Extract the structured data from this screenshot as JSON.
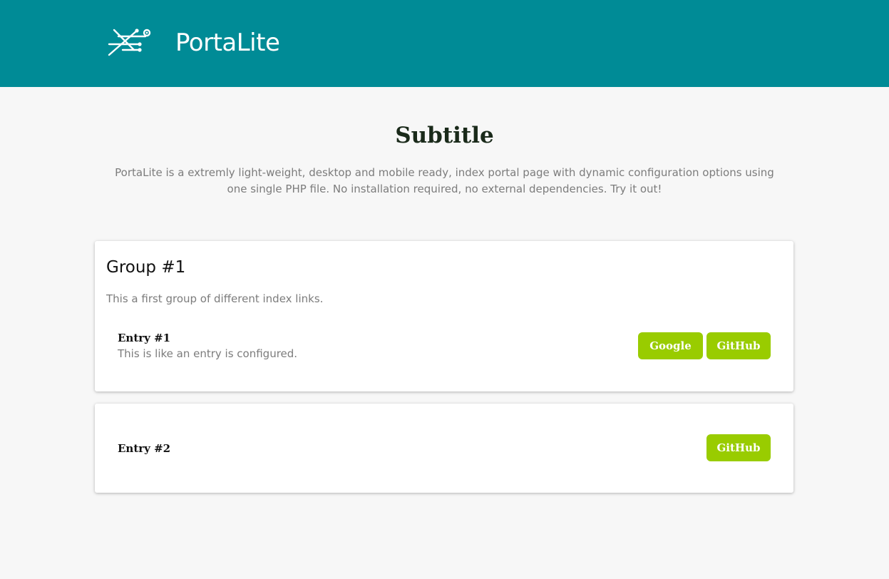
{
  "header": {
    "app_title": "PortaLite",
    "logo_icon": "circuit-logo-icon",
    "background_color": "#008b96"
  },
  "hero": {
    "subtitle": "Subtitle",
    "intro": "PortaLite is a extremly light-weight, desktop and mobile ready, index portal page with dynamic configuration options using one single PHP file. No installation required, no external dependencies. Try it out!"
  },
  "groups": [
    {
      "title": "Group #1",
      "description": "This a first group of different index links.",
      "entries": [
        {
          "title": "Entry #1",
          "description": "This is like an entry is configured.",
          "links": [
            "Google",
            "GitHub"
          ]
        }
      ]
    },
    {
      "title": "",
      "description": "",
      "entries": [
        {
          "title": "Entry #2",
          "description": "",
          "links": [
            "GitHub"
          ]
        }
      ]
    }
  ],
  "colors": {
    "accent": "#99cc00",
    "page_background": "#f7f7f7"
  }
}
